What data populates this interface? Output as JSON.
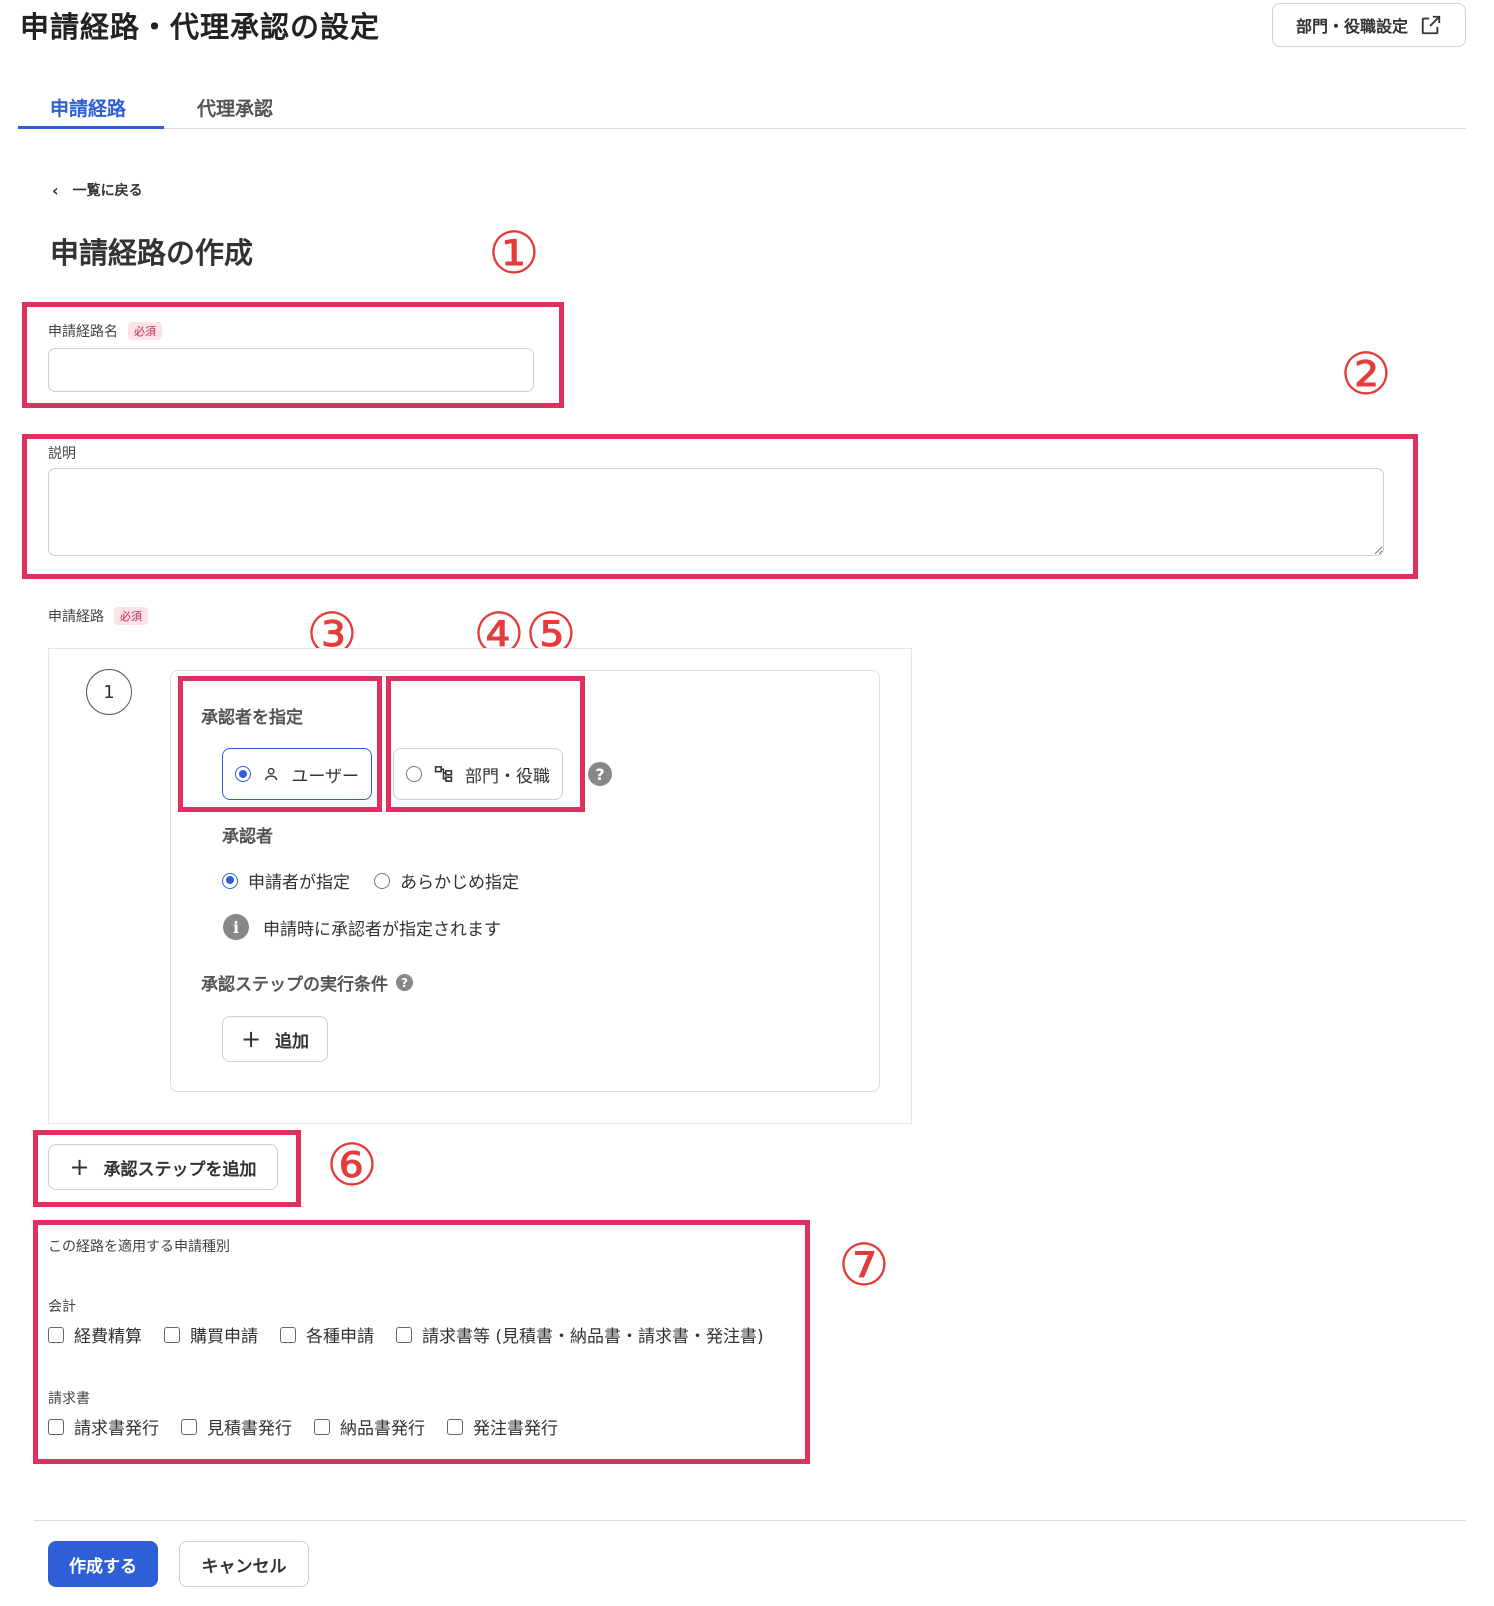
{
  "header": {
    "title": "申請経路・代理承認の設定",
    "settings_link_label": "部門・役職設定"
  },
  "tabs": [
    {
      "label": "申請経路",
      "active": true
    },
    {
      "label": "代理承認",
      "active": false
    }
  ],
  "back_link": "一覧に戻る",
  "section_title": "申請経路の作成",
  "annotations": [
    "①",
    "②",
    "③",
    "④⑤",
    "⑥",
    "⑦"
  ],
  "route_name": {
    "label": "申請経路名",
    "required_badge": "必須",
    "value": ""
  },
  "description": {
    "label": "説明",
    "value": ""
  },
  "route": {
    "label": "申請経路",
    "required_badge": "必須",
    "step_number": "1",
    "approver_type_heading": "承認者を指定",
    "approver_type_options": [
      {
        "label": "ユーザー",
        "selected": true
      },
      {
        "label": "部門・役職",
        "selected": false
      }
    ],
    "approver_heading": "承認者",
    "approver_options": [
      {
        "label": "申請者が指定",
        "selected": true
      },
      {
        "label": "あらかじめ指定",
        "selected": false
      }
    ],
    "info_text": "申請時に承認者が指定されます",
    "condition_heading": "承認ステップの実行条件",
    "add_button": "追加"
  },
  "add_step_button": "承認ステップを追加",
  "apply_types": {
    "heading": "この経路を適用する申請種別",
    "categories": [
      {
        "name": "会計",
        "items": [
          "経費精算",
          "購買申請",
          "各種申請",
          "請求書等 (見積書・納品書・請求書・発注書)"
        ]
      },
      {
        "name": "請求書",
        "items": [
          "請求書発行",
          "見積書発行",
          "納品書発行",
          "発注書発行"
        ]
      }
    ]
  },
  "footer": {
    "submit_label": "作成する",
    "cancel_label": "キャンセル"
  },
  "colors": {
    "accent": "#2f5fd6",
    "highlight": "#e0305e",
    "annotation": "#e43b3b"
  }
}
